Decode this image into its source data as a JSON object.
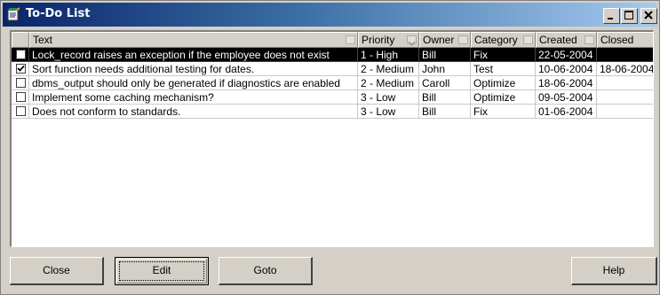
{
  "window": {
    "title": "To-Do List",
    "controls": {
      "minimize": "_",
      "maximize": "□",
      "close": "×"
    }
  },
  "table": {
    "columns": [
      "",
      "Text",
      "Priority",
      "Owner",
      "Category",
      "Created",
      "Closed"
    ],
    "rows": [
      {
        "checked": false,
        "selected": true,
        "text": "Lock_record raises an exception if the employee does not exist",
        "priority": "1 - High",
        "owner": "Bill",
        "category": "Fix",
        "created": "22-05-2004",
        "closed": ""
      },
      {
        "checked": true,
        "selected": false,
        "text": "Sort function needs additional testing for dates.",
        "priority": "2 - Medium",
        "owner": "John",
        "category": "Test",
        "created": "10-06-2004",
        "closed": "18-06-2004"
      },
      {
        "checked": false,
        "selected": false,
        "text": "dbms_output should only be generated if diagnostics are enabled",
        "priority": "2 - Medium",
        "owner": "Caroll",
        "category": "Optimize",
        "created": "18-06-2004",
        "closed": ""
      },
      {
        "checked": false,
        "selected": false,
        "text": "Implement some caching mechanism?",
        "priority": "3 - Low",
        "owner": "Bill",
        "category": "Optimize",
        "created": "09-05-2004",
        "closed": ""
      },
      {
        "checked": false,
        "selected": false,
        "text": "Does not conform to standards.",
        "priority": "3 - Low",
        "owner": "Bill",
        "category": "Fix",
        "created": "01-06-2004",
        "closed": ""
      }
    ]
  },
  "buttons": {
    "close": "Close",
    "edit": "Edit",
    "goto": "Goto",
    "help": "Help"
  },
  "colors": {
    "titlebar_start": "#0a246a",
    "titlebar_end": "#a6caf0",
    "selection": "#000000",
    "face": "#d4d0c8"
  },
  "icons": {
    "app": "notepad-icon",
    "checked": "check-mark-icon"
  }
}
